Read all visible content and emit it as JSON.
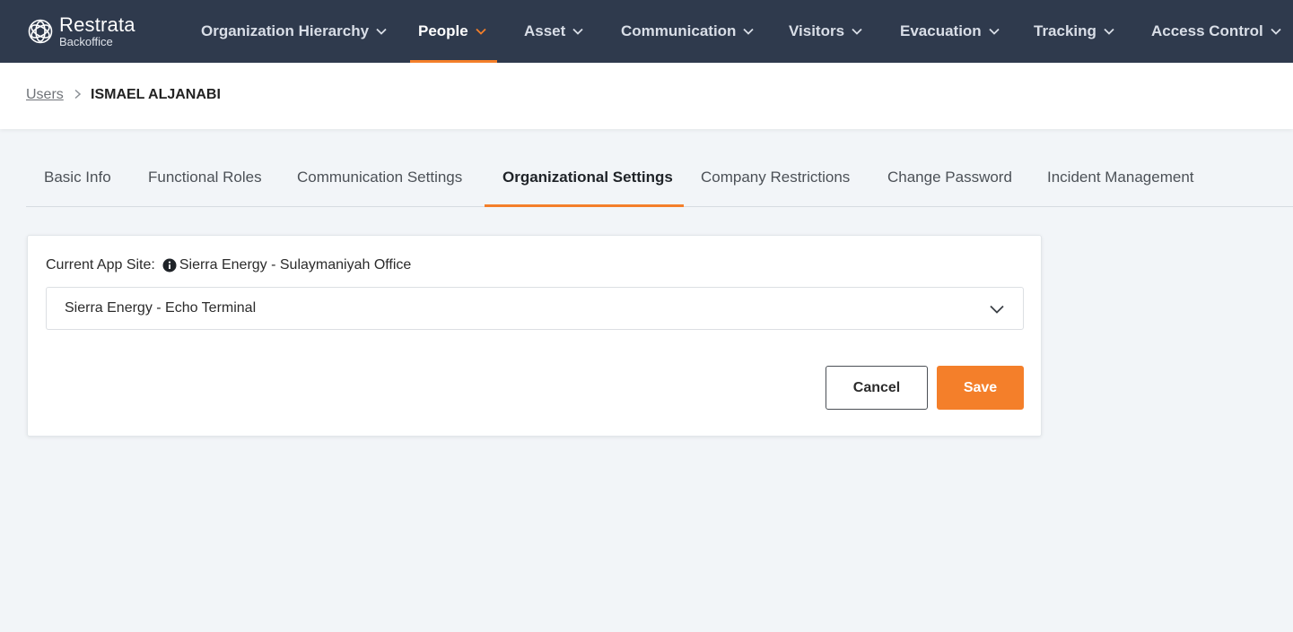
{
  "brand": {
    "name": "Restrata",
    "subtitle": "Backoffice"
  },
  "nav": {
    "items": [
      {
        "label": "Organization Hierarchy"
      },
      {
        "label": "People"
      },
      {
        "label": "Asset"
      },
      {
        "label": "Communication"
      },
      {
        "label": "Visitors"
      },
      {
        "label": "Evacuation"
      },
      {
        "label": "Tracking"
      },
      {
        "label": "Access Control"
      }
    ],
    "active": "People"
  },
  "breadcrumb": {
    "parent": "Users",
    "current": "ISMAEL ALJANABI"
  },
  "tabs": {
    "items": [
      {
        "label": "Basic Info"
      },
      {
        "label": "Functional Roles"
      },
      {
        "label": "Communication Settings"
      },
      {
        "label": "Organizational Settings"
      },
      {
        "label": "Company Restrictions"
      },
      {
        "label": "Change Password"
      },
      {
        "label": "Incident Management"
      }
    ],
    "active": "Organizational Settings"
  },
  "form": {
    "current_site_label": "Current App Site:",
    "current_site_value": "Sierra Energy - Sulaymaniyah Office",
    "site_select_value": "Sierra Energy - Echo Terminal",
    "cancel_label": "Cancel",
    "save_label": "Save"
  },
  "colors": {
    "nav_background": "#2f3a4d",
    "accent": "#f47f2a",
    "page_background": "#f2f5f8"
  },
  "icons": {
    "logo": "restrata-logo-icon",
    "chevron": "chevron-down-icon",
    "breadcrumb_separator": "chevron-right-icon",
    "info": "info-circle-icon"
  }
}
